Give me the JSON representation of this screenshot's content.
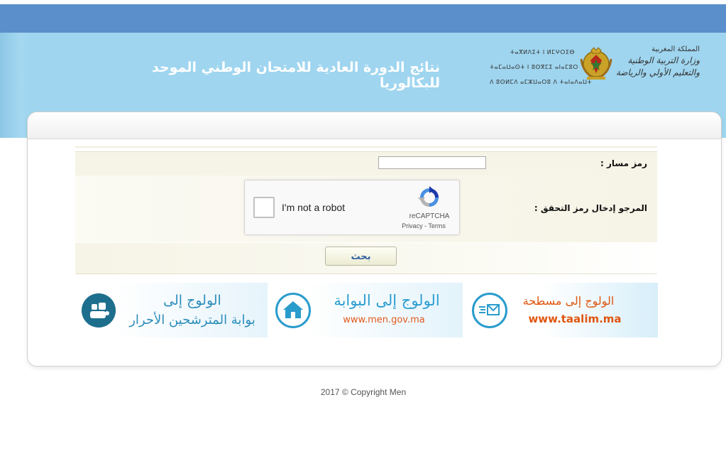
{
  "header": {
    "title": "نتائج الدورة العادية للامتحان الوطني الموحد للبكالوريا",
    "ministry_ar": [
      "المملكة المغربية",
      "وزارة التربية الوطنية",
      "والتعليم الأولي والرياضة"
    ],
    "ministry_tz": [
      "ⵜⴰⴳⵍⴷⵉⵜ ⵏ ⵍⵎⵖⵔⵉⴱ",
      "ⵜⴰⵎⴰⵡⴰⵙⵜ ⵏ ⵓⵙⴳⵎⵉ ⴰⵏⴰⵎⵓⵔ",
      "ⴷ ⵓⵙⵍⵎⴷ ⴰⵎⵣⵡⴰⵔⵓ ⴷ ⵜⴰⵏⴰⴷⴰⵡⵜ"
    ]
  },
  "form": {
    "massar_label": "رمز مسار :",
    "massar_value": "",
    "captcha_label": "المرجو إدخال رمز التحقق :",
    "search_button": "بحث"
  },
  "captcha": {
    "text": "I'm not a robot",
    "brand": "reCAPTCHA",
    "privacy": "Privacy",
    "separator": " - ",
    "terms": "Terms"
  },
  "tiles": [
    {
      "line1": "الولوج إلى",
      "line2": "بوابة المترشحين الأحرار"
    },
    {
      "line1": "الولوج إلى البوابة",
      "line2": "www.men.gov.ma"
    },
    {
      "line1": "الولوج إلى مسطحة",
      "line2": "www.taalim.ma"
    }
  ],
  "footer": {
    "copyright": "2017 © Copyright Men"
  },
  "colors": {
    "topbar": "#5a8fcb",
    "banner": "#9fd5ef",
    "tile_blue": "#2b9dd0",
    "tile_orange": "#e0560f"
  },
  "icons": {
    "tile1": "community-icon",
    "tile2": "home-icon",
    "tile3": "mail-list-icon"
  }
}
